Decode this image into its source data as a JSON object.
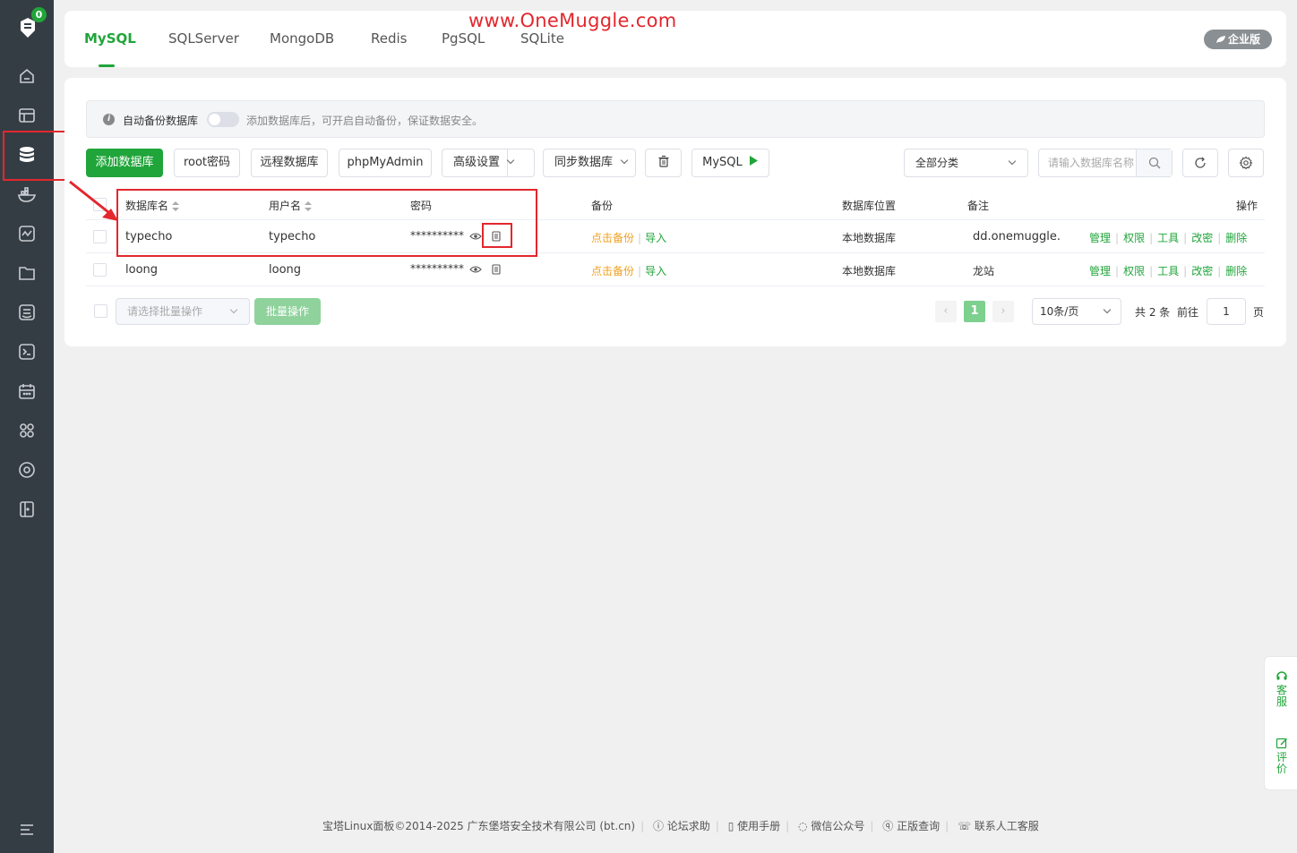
{
  "sidebar": {
    "badge": "0",
    "items": [
      "home-icon",
      "website-icon",
      "database-icon",
      "docker-icon",
      "monitor-icon",
      "files-icon",
      "logs-icon",
      "terminal-icon",
      "cron-icon",
      "apps-icon",
      "settings-icon",
      "logout-icon"
    ]
  },
  "tabs": [
    "MySQL",
    "SQLServer",
    "MongoDB",
    "Redis",
    "PgSQL",
    "SQLite"
  ],
  "watermark": "www.OneMuggle.com",
  "enterprise_label": "企业版",
  "notice": {
    "label": "自动备份数据库",
    "hint": "添加数据库后，可开启自动备份，保证数据安全。"
  },
  "toolbar": {
    "add_db": "添加数据库",
    "root_pwd": "root密码",
    "remote_db": "远程数据库",
    "phpmyadmin": "phpMyAdmin",
    "advanced": "高级设置",
    "sync": "同步数据库",
    "mysql": "MySQL",
    "category": "全部分类",
    "search_placeholder": "请输入数据库名称"
  },
  "table": {
    "headers": {
      "name": "数据库名",
      "user": "用户名",
      "password": "密码",
      "backup": "备份",
      "location": "数据库位置",
      "remark": "备注",
      "ops": "操作"
    },
    "rows": [
      {
        "name": "typecho",
        "user": "typecho",
        "password": "**********",
        "backup": "点击备份",
        "import": "导入",
        "location": "本地数据库",
        "remark": "dd.onemuggle.cc"
      },
      {
        "name": "loong",
        "user": "loong",
        "password": "**********",
        "backup": "点击备份",
        "import": "导入",
        "location": "本地数据库",
        "remark": "龙站"
      }
    ],
    "ops": [
      "管理",
      "权限",
      "工具",
      "改密",
      "删除"
    ]
  },
  "bottom": {
    "batch_placeholder": "请选择批量操作",
    "batch_btn": "批量操作",
    "current_page": "1",
    "page_size": "10条/页",
    "total": "共 2 条",
    "goto": "前往",
    "goto_value": "1",
    "page_unit": "页"
  },
  "float": {
    "service": "客服",
    "review": "评价"
  },
  "footer": {
    "copyright": "宝塔Linux面板©2014-2025 广东堡塔安全技术有限公司 (bt.cn)",
    "links": [
      "论坛求助",
      "使用手册",
      "微信公众号",
      "正版查询",
      "联系人工客服"
    ]
  },
  "colors": {
    "brand": "#20a53a",
    "sidebar": "#353d44",
    "highlight": "#e3272d",
    "backup_link": "#f0a020"
  }
}
